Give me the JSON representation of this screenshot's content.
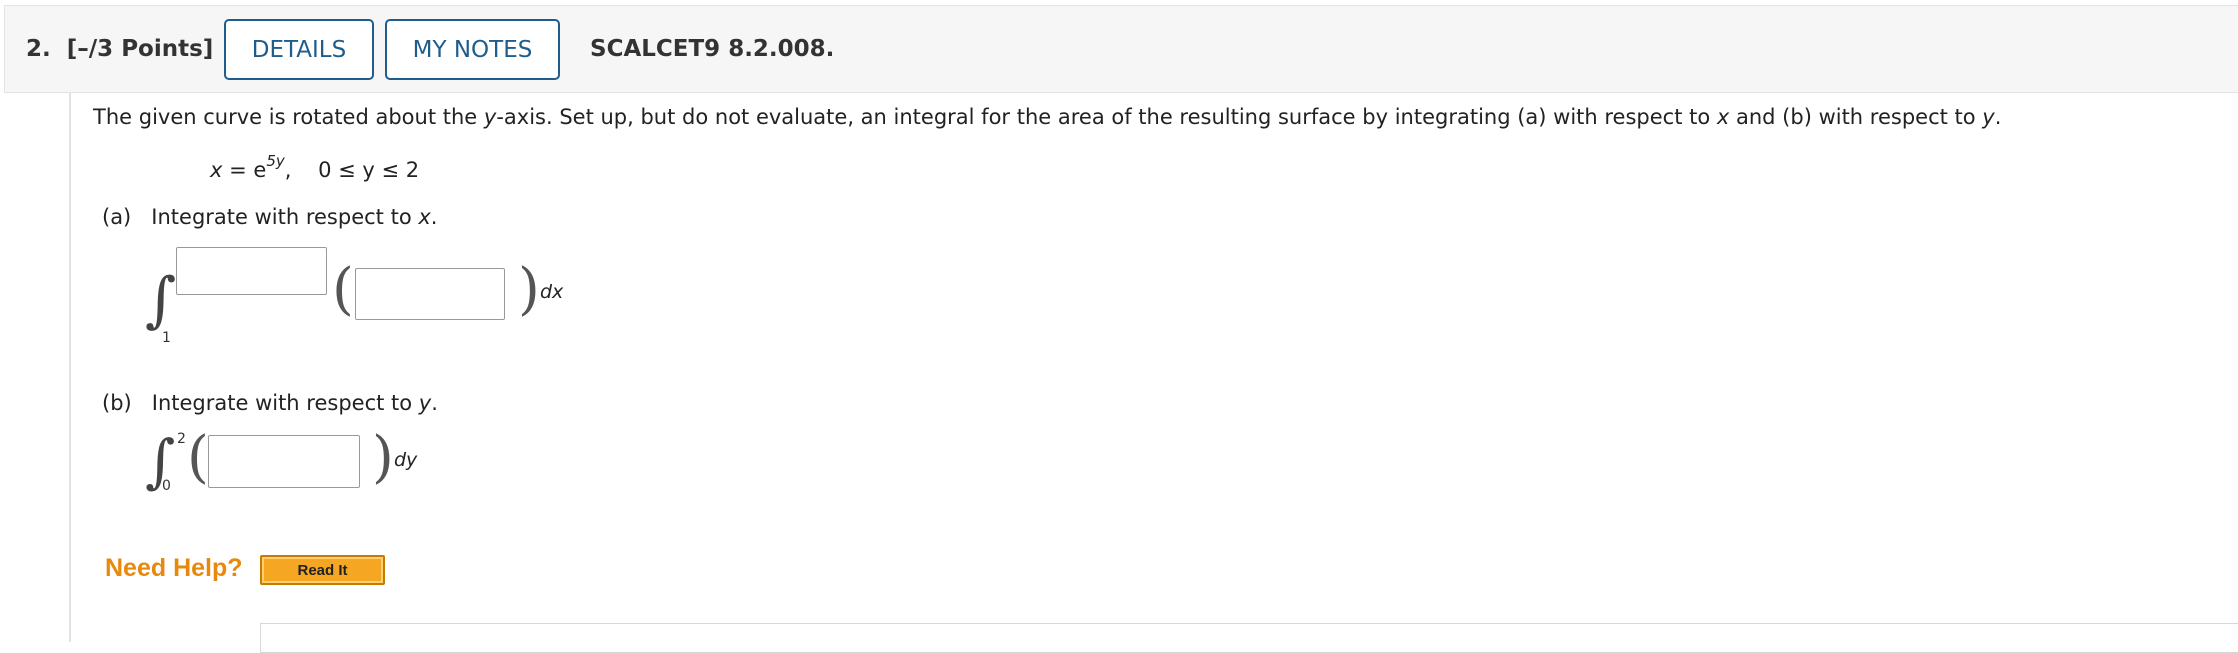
{
  "header": {
    "question_number": "2.",
    "points": "[–/3 Points]",
    "details_label": "DETAILS",
    "notes_label": "MY NOTES",
    "question_id": "SCALCET9 8.2.008."
  },
  "problem": {
    "intro_1": "The given curve is rotated about the ",
    "intro_y": "y",
    "intro_2": "-axis. Set up, but do not evaluate, an integral for the area of the resulting surface by integrating (a) with respect to ",
    "intro_x": "x",
    "intro_3": " and (b) with respect to ",
    "intro_y2": "y",
    "intro_4": ".",
    "eq_lhs": "x",
    "eq_mid": " = e",
    "eq_exp": "5y",
    "eq_rest": ",    0 ≤ y ≤ 2"
  },
  "part_a": {
    "label": "(a)",
    "text": "Integrate with respect to ",
    "var": "x",
    "period": ".",
    "lower_limit": "1",
    "upper_limit_value": "",
    "integrand_value": "",
    "differential": "dx"
  },
  "part_b": {
    "label": "(b)",
    "text": "Integrate with respect to ",
    "var": "y",
    "period": ".",
    "lower_limit": "0",
    "upper_limit": "2",
    "integrand_value": "",
    "differential": "dy"
  },
  "help": {
    "label": "Need Help?",
    "read_it": "Read It"
  }
}
